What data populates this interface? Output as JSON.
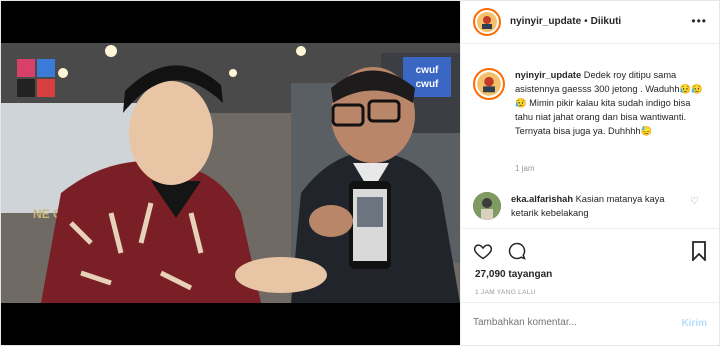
{
  "post": {
    "username": "nyinyir_update",
    "dot": "•",
    "follow_status": "Diikuti",
    "more_icon": "more-horizontal-icon",
    "caption_user": "nyinyir_update",
    "caption_text": "Dedek roy ditipu sama asistennya gaesss 300 jetong . Waduhh😥😥😥 Mimin pikir kalau kita sudah indigo bisa tahu niat jahat orang dan bisa wantiwanti. Ternyata bisa juga ya. Duhhhh😓",
    "caption_time": "1 jam",
    "comments": [
      {
        "user": "eka.alfarishah",
        "text": "Kasian matanya kaya ketarik kebelakang"
      }
    ],
    "views": "27,090 tayangan",
    "posted_ago": "1 JAM YANG LALU",
    "comment_placeholder": "Tambahkan komentar...",
    "send_label": "Kirim"
  },
  "video": {
    "overlay_text": "cwuf cwuf",
    "sign_text": "NG"
  },
  "colors": {
    "accent": "#ff6b00",
    "send_disabled": "#b2dffc",
    "muted": "#999999"
  }
}
